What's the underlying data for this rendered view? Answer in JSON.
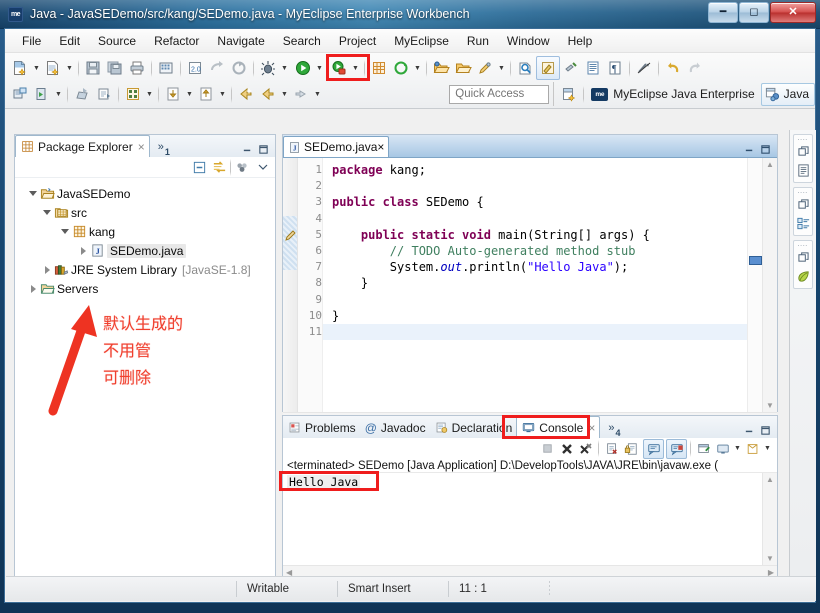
{
  "window": {
    "title": "Java - JavaSEDemo/src/kang/SEDemo.java - MyEclipse Enterprise Workbench",
    "app_badge": "me",
    "minimize": "–",
    "maximize": "□",
    "close": "✕"
  },
  "menu": {
    "items": [
      {
        "label": "File"
      },
      {
        "label": "Edit"
      },
      {
        "label": "Source"
      },
      {
        "label": "Refactor"
      },
      {
        "label": "Navigate"
      },
      {
        "label": "Search"
      },
      {
        "label": "Project"
      },
      {
        "label": "MyEclipse"
      },
      {
        "label": "Run"
      },
      {
        "label": "Window"
      },
      {
        "label": "Help"
      }
    ]
  },
  "toolbar": {
    "row1": [
      {
        "name": "new-wizard-icon",
        "dropdown": true
      },
      {
        "name": "new-java-class-icon",
        "dropdown": true
      },
      {
        "sep": true
      },
      {
        "name": "save-icon",
        "dropdown": false
      },
      {
        "name": "save-all-icon",
        "dropdown": false
      },
      {
        "name": "print-icon",
        "dropdown": false
      },
      {
        "sep": true
      },
      {
        "name": "open-type-icon",
        "dropdown": false
      },
      {
        "sep": true
      },
      {
        "name": "build-all-icon",
        "dropdown": false
      },
      {
        "name": "forward-history-icon",
        "dropdown": false
      },
      {
        "name": "undo-build-icon",
        "dropdown": false
      },
      {
        "sep": true
      },
      {
        "name": "debug-icon",
        "dropdown": true
      },
      {
        "name": "run-icon",
        "dropdown": true,
        "highlighted": true
      },
      {
        "name": "run-external-tools-icon",
        "dropdown": true
      },
      {
        "sep": true
      },
      {
        "name": "new-package-icon",
        "dropdown": false
      },
      {
        "name": "refresh-icon",
        "dropdown": true
      },
      {
        "sep": true
      },
      {
        "name": "open-perspective-icon",
        "dropdown": false
      },
      {
        "name": "open-folder-icon",
        "dropdown": false
      },
      {
        "name": "edit-marker-icon",
        "dropdown": true
      },
      {
        "sep": true
      },
      {
        "name": "search-icon",
        "dropdown": false
      },
      {
        "name": "toggle-mark-occurrences-icon",
        "dropdown": false,
        "pressed": true
      },
      {
        "name": "link-editor-icon",
        "dropdown": false
      },
      {
        "name": "show-whitespace-icon",
        "dropdown": false
      },
      {
        "name": "pilcrow-icon",
        "dropdown": false
      },
      {
        "sep": true
      },
      {
        "name": "skip-breakpoints-icon",
        "dropdown": false
      },
      {
        "sep": true
      },
      {
        "name": "undo-icon",
        "dropdown": false
      },
      {
        "name": "redo-icon",
        "dropdown": false
      }
    ],
    "row2": [
      {
        "name": "new-java-project-icon",
        "dropdown": false
      },
      {
        "name": "run-server-icon",
        "dropdown": true
      },
      {
        "sep": true
      },
      {
        "name": "deploy-icon",
        "dropdown": false
      },
      {
        "name": "export-icon",
        "dropdown": false
      },
      {
        "sep": true
      },
      {
        "name": "database-explorer-icon",
        "dropdown": true
      },
      {
        "sep": true
      },
      {
        "name": "step-into-icon",
        "dropdown": true
      },
      {
        "name": "step-over-icon",
        "dropdown": true
      },
      {
        "sep": true
      },
      {
        "name": "back-nav-icon",
        "dropdown": false
      },
      {
        "name": "previous-annotation-icon",
        "dropdown": true
      },
      {
        "name": "next-annotation-icon",
        "dropdown": true
      }
    ],
    "quick_access_placeholder": "Quick Access",
    "perspective_new_icon": "new-perspective-icon",
    "perspectives": [
      {
        "label": "MyEclipse Java Enterprise",
        "icon": "myeclipse-badge",
        "selected": false
      },
      {
        "label": "Java",
        "icon": "java-perspective-icon",
        "selected": true
      }
    ]
  },
  "package_explorer": {
    "tab_label": "Package Explorer",
    "tab_close": "×",
    "overflow_label": "»",
    "overflow_count": "1",
    "minimize_label": "–",
    "maximize_label": "❐",
    "view_toolbar": [
      {
        "name": "collapse-all-icon"
      },
      {
        "name": "link-with-editor-icon"
      },
      {
        "name": "focus-on-active-task-icon"
      },
      {
        "name": "view-menu-icon"
      }
    ],
    "tree": [
      {
        "label": "JavaSEDemo",
        "indent": 0,
        "twisty": "open",
        "icon": "java-project-icon",
        "selected": false
      },
      {
        "label": "src",
        "indent": 1,
        "twisty": "open",
        "icon": "source-folder-icon",
        "selected": false
      },
      {
        "label": "kang",
        "indent": 2,
        "twisty": "open",
        "icon": "package-icon",
        "selected": false
      },
      {
        "label": "SEDemo.java",
        "indent": 3,
        "twisty": "closed",
        "icon": "java-file-icon",
        "selected": true
      },
      {
        "label": "JRE System Library",
        "suffix": "[JavaSE-1.8]",
        "indent": 1,
        "twisty": "closed",
        "icon": "jre-library-icon",
        "selected": false
      },
      {
        "label": "Servers",
        "indent": 0,
        "twisty": "closed",
        "icon": "folder-icon",
        "selected": false
      }
    ]
  },
  "annotation": {
    "lines": [
      "默认生成的",
      "不用管",
      "可删除"
    ],
    "color": "#f0402f",
    "arrow": "red-arrow-pointing-to-servers"
  },
  "editor": {
    "tab_label": "SEDemo.java",
    "tab_close": "×",
    "tab_icon": "java-file-icon",
    "minimize_label": "–",
    "maximize_label": "❐",
    "line_numbers": [
      "1",
      "2",
      "3",
      "4",
      "5",
      "6",
      "7",
      "8",
      "9",
      "10",
      "11"
    ],
    "current_line": 11,
    "folding_line": 5,
    "code": [
      {
        "n": 1,
        "tokens": [
          {
            "t": "kw",
            "v": "package"
          },
          {
            "t": "p",
            "v": " kang;"
          }
        ]
      },
      {
        "n": 2,
        "tokens": []
      },
      {
        "n": 3,
        "tokens": [
          {
            "t": "kw",
            "v": "public class"
          },
          {
            "t": "p",
            "v": " SEDemo {"
          }
        ]
      },
      {
        "n": 4,
        "tokens": []
      },
      {
        "n": 5,
        "tokens": [
          {
            "t": "p",
            "v": "    "
          },
          {
            "t": "kw",
            "v": "public static void"
          },
          {
            "t": "p",
            "v": " main(String[] args) {"
          }
        ]
      },
      {
        "n": 6,
        "tokens": [
          {
            "t": "p",
            "v": "        "
          },
          {
            "t": "cmt",
            "v": "// TODO Auto-generated method stub"
          }
        ]
      },
      {
        "n": 7,
        "tokens": [
          {
            "t": "p",
            "v": "        System."
          },
          {
            "t": "fld",
            "v": "out"
          },
          {
            "t": "p",
            "v": ".println("
          },
          {
            "t": "str",
            "v": "\"Hello Java\""
          },
          {
            "t": "p",
            "v": ");"
          }
        ]
      },
      {
        "n": 8,
        "tokens": [
          {
            "t": "p",
            "v": "    }"
          }
        ]
      },
      {
        "n": 9,
        "tokens": []
      },
      {
        "n": 10,
        "tokens": [
          {
            "t": "p",
            "v": "}"
          }
        ]
      },
      {
        "n": 11,
        "tokens": []
      }
    ]
  },
  "bottom_panel": {
    "tabs": [
      {
        "label": "Problems",
        "icon": "problems-icon",
        "active": false
      },
      {
        "label": "Javadoc",
        "icon": "javadoc-at-icon",
        "active": false
      },
      {
        "label": "Declaration",
        "icon": "declaration-icon",
        "active": false
      },
      {
        "label": "Console",
        "icon": "console-icon",
        "active": true,
        "highlighted": true
      }
    ],
    "tab_close": "×",
    "overflow_label": "»",
    "overflow_count": "4",
    "minimize_label": "–",
    "maximize_label": "❐",
    "console_toolbar": [
      {
        "name": "terminate-icon",
        "disabled": true
      },
      {
        "name": "remove-launch-icon"
      },
      {
        "name": "remove-all-terminated-icon"
      },
      {
        "name": "clear-console-icon"
      },
      {
        "name": "lock-scroll-icon"
      },
      {
        "name": "scroll-lock-icon",
        "pressed": true
      },
      {
        "name": "show-console-on-output-icon",
        "pressed": true
      },
      {
        "name": "pin-console-icon"
      },
      {
        "name": "display-selected-console-icon",
        "dropdown": true
      },
      {
        "name": "open-console-icon",
        "dropdown": true
      }
    ],
    "terminated_line": "<terminated> SEDemo [Java Application] D:\\DevelopTools\\JAVA\\JRE\\bin\\javaw.exe (",
    "output": "Hello Java",
    "output_highlighted": true
  },
  "right_strip": {
    "groups": [
      [
        {
          "name": "restore-icon"
        },
        {
          "name": "outline-document-icon"
        }
      ],
      [
        {
          "name": "restore-icon"
        },
        {
          "name": "package-explorer-small-icon"
        }
      ],
      [
        {
          "name": "restore-icon"
        },
        {
          "name": "myeclipse-leaf-icon"
        }
      ]
    ]
  },
  "status_bar": {
    "writable": "Writable",
    "insert_mode": "Smart Insert",
    "position": "11 : 1"
  },
  "colors": {
    "accent_red": "#ef1d1d",
    "keyword": "#7f0055",
    "comment": "#3f7f5f",
    "string": "#2a00ff",
    "field": "#0000c0",
    "title_blue": "#2a6f9e"
  }
}
